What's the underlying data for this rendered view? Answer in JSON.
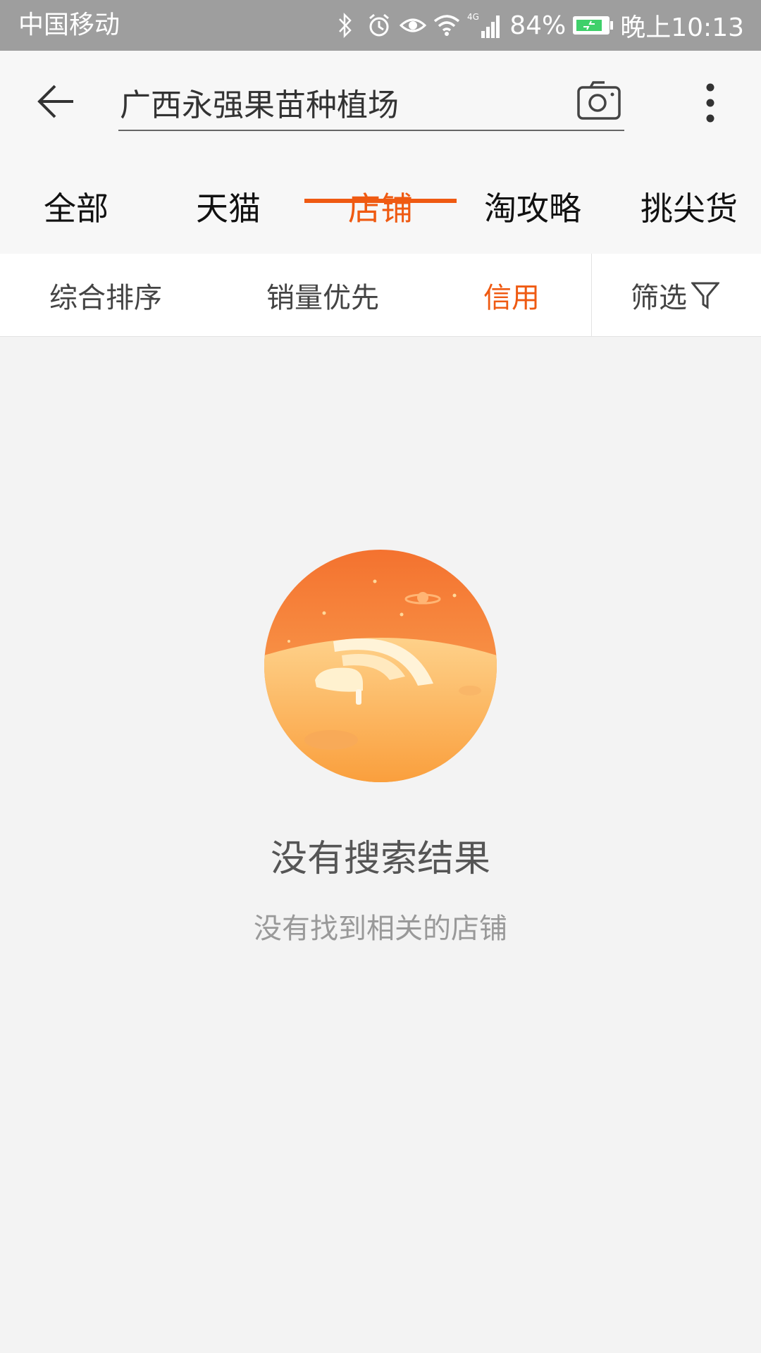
{
  "status_bar": {
    "carrier": "中国移动",
    "network": "4G",
    "battery": "84%",
    "time": "晚上10:13",
    "icons": [
      "bluetooth-icon",
      "alarm-icon",
      "eye-icon",
      "wifi-icon",
      "signal-icon",
      "battery-icon"
    ]
  },
  "search": {
    "query": "广西永强果苗种植场"
  },
  "tabs": [
    {
      "label": "全部"
    },
    {
      "label": "天猫"
    },
    {
      "label": "店铺"
    },
    {
      "label": "淘攻略"
    },
    {
      "label": "挑尖货"
    }
  ],
  "active_tab": "店铺",
  "sort": {
    "comprehensive": "综合排序",
    "sales": "销量优先",
    "credit": "信用",
    "filter": "筛选",
    "active": "信用"
  },
  "empty_state": {
    "title": "没有搜索结果",
    "subtitle": "没有找到相关的店铺"
  },
  "colors": {
    "accent": "#ef5a12",
    "status_bar": "#9e9e9e",
    "background": "#f3f3f3"
  }
}
